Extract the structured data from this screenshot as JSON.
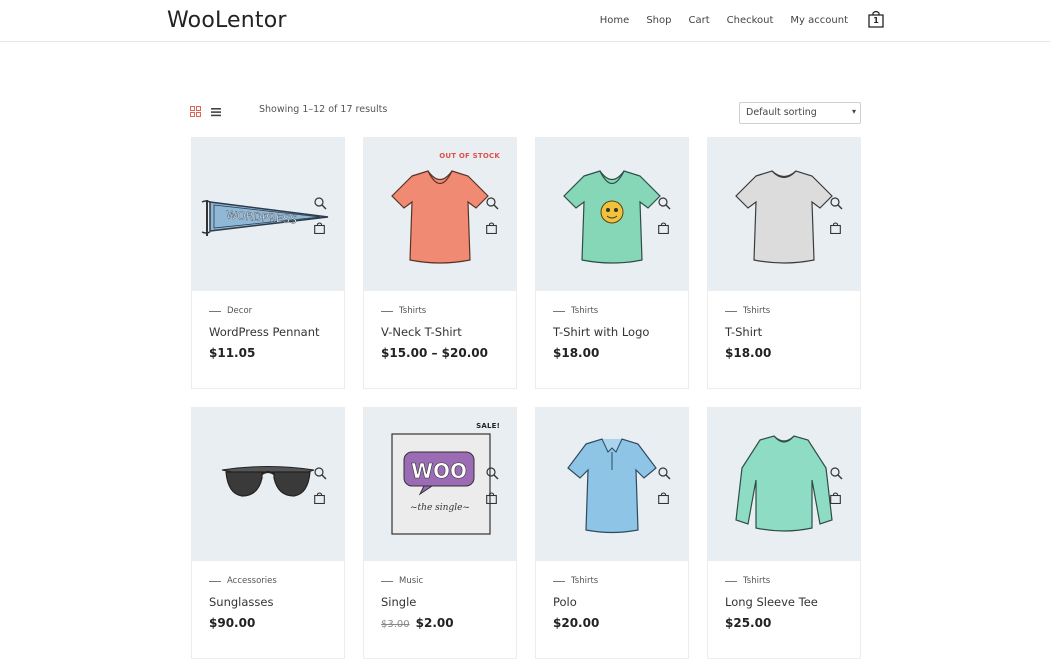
{
  "header": {
    "logo": "WooLentor",
    "nav": [
      "Home",
      "Shop",
      "Cart",
      "Checkout",
      "My account"
    ],
    "cart_count": "1"
  },
  "toolbar": {
    "result_count": "Showing 1–12 of 17 results",
    "sorting": "Default sorting"
  },
  "colors": {
    "accent_sale": "#e0514a",
    "thumb_bg": "#e9eef2"
  },
  "products": [
    {
      "category": "Decor",
      "title": "WordPress Pennant",
      "price": "$11.05",
      "badge": "",
      "icon": "pennant"
    },
    {
      "category": "Tshirts",
      "title": "V-Neck T-Shirt",
      "price": "$15.00 – $20.00",
      "badge": "OUT OF STOCK",
      "icon": "vneck-shirt-orange"
    },
    {
      "category": "Tshirts",
      "title": "T-Shirt with Logo",
      "price": "$18.00",
      "badge": "",
      "icon": "shirt-with-logo"
    },
    {
      "category": "Tshirts",
      "title": "T-Shirt",
      "price": "$18.00",
      "badge": "",
      "icon": "shirt-grey"
    },
    {
      "category": "Accessories",
      "title": "Sunglasses",
      "price": "$90.00",
      "badge": "",
      "icon": "sunglasses"
    },
    {
      "category": "Music",
      "title": "Single",
      "old_price": "$3.00",
      "price": "$2.00",
      "badge": "SALE!",
      "icon": "woo-single"
    },
    {
      "category": "Tshirts",
      "title": "Polo",
      "price": "$20.00",
      "badge": "",
      "icon": "polo-shirt"
    },
    {
      "category": "Tshirts",
      "title": "Long Sleeve Tee",
      "price": "$25.00",
      "badge": "",
      "icon": "long-sleeve-tee"
    }
  ]
}
